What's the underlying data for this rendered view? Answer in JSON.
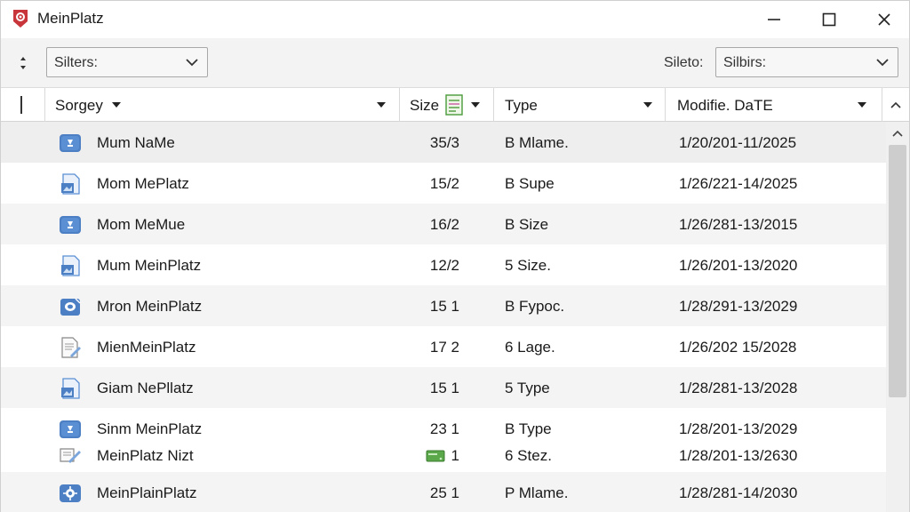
{
  "window": {
    "title": "MeinPlatz",
    "app_icon": "app-logo-icon",
    "accent_color": "#c8353a"
  },
  "toolbar": {
    "sort_toggle_icon": "up-down-arrows-icon",
    "left_select_value": "Silters:",
    "filter_label": "Sileto:",
    "right_select_value": "Silbirs:"
  },
  "columns": {
    "name": "Sorgey",
    "size": "Size",
    "type": "Type",
    "date": "Modifie. DaTE"
  },
  "rows": [
    {
      "icon": "blue-disk-icon",
      "name": "Mum NaMe",
      "size": "35/3",
      "type": "B Mlame.",
      "date": "1/20/201-11/2025"
    },
    {
      "icon": "document-image-icon",
      "name": "Mom MePlatz",
      "size": "15/2",
      "type": "B Supe",
      "date": "1/26/221-14/2025"
    },
    {
      "icon": "blue-disk-icon",
      "name": "Mom MeMue",
      "size": "16/2",
      "type": "B Size",
      "date": "1/26/281-13/2015"
    },
    {
      "icon": "document-image-icon",
      "name": "Mum MeinPlatz",
      "size": "12/2",
      "type": "5 Size.",
      "date": "1/26/201-13/2020"
    },
    {
      "icon": "blue-disk-drive-icon",
      "name": "Mron MeinPlatz",
      "size": "15 1",
      "type": "B Fypoc.",
      "date": "1/28/291-13/2029"
    },
    {
      "icon": "text-document-icon",
      "name": "MienMeinPlatz",
      "size": "17 2",
      "type": "6 Lage.",
      "date": "1/26/202 15/2028"
    },
    {
      "icon": "document-image-icon",
      "name": "Giam NePllatz",
      "size": "15 1",
      "type": "5 Type",
      "date": "1/28/281-13/2028"
    },
    {
      "icon": "blue-disk-icon",
      "name": "Sinm MeinPlatz",
      "size": "23 1",
      "type": "B Type",
      "date": "1/28/201-13/2029"
    },
    {
      "icon": "text-document-pen-icon",
      "name": "MeinPlatz Nizt",
      "size": "1",
      "type": "6 Stez.",
      "date": "1/28/201-13/2630",
      "size_icon": "green-drive-icon"
    },
    {
      "icon": "blue-gear-disk-icon",
      "name": "MeinPlainPlatz",
      "size": "25 1",
      "type": "P Mlame.",
      "date": "1/28/281-14/2030"
    }
  ]
}
